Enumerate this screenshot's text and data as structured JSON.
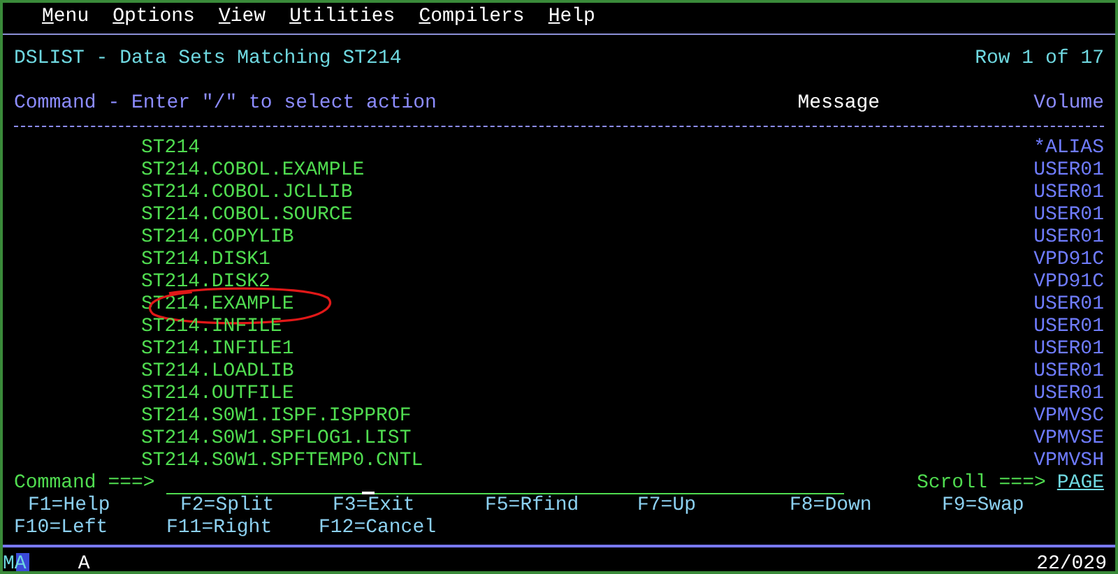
{
  "menu": [
    "Menu",
    "Options",
    "View",
    "Utilities",
    "Compilers",
    "Help"
  ],
  "title": "DSLIST - Data Sets Matching ST214",
  "row_info": "Row 1 of 17",
  "header": {
    "command": "Command - Enter \"/\" to select action",
    "message": "Message",
    "volume": "Volume"
  },
  "rows": [
    {
      "name": "ST214",
      "volume": "*ALIAS",
      "circled": false
    },
    {
      "name": "ST214.COBOL.EXAMPLE",
      "volume": "USER01",
      "circled": false
    },
    {
      "name": "ST214.COBOL.JCLLIB",
      "volume": "USER01",
      "circled": false
    },
    {
      "name": "ST214.COBOL.SOURCE",
      "volume": "USER01",
      "circled": false
    },
    {
      "name": "ST214.COPYLIB",
      "volume": "USER01",
      "circled": false
    },
    {
      "name": "ST214.DISK1",
      "volume": "VPD91C",
      "circled": false
    },
    {
      "name": "ST214.DISK2",
      "volume": "VPD91C",
      "circled": false
    },
    {
      "name": "ST214.EXAMPLE",
      "volume": "USER01",
      "circled": true
    },
    {
      "name": "ST214.INFILE",
      "volume": "USER01",
      "circled": false
    },
    {
      "name": "ST214.INFILE1",
      "volume": "USER01",
      "circled": false
    },
    {
      "name": "ST214.LOADLIB",
      "volume": "USER01",
      "circled": false
    },
    {
      "name": "ST214.OUTFILE",
      "volume": "USER01",
      "circled": false
    },
    {
      "name": "ST214.S0W1.ISPF.ISPPROF",
      "volume": "VPMVSC",
      "circled": false
    },
    {
      "name": "ST214.S0W1.SPFLOG1.LIST",
      "volume": "VPMVSE",
      "circled": false
    },
    {
      "name": "ST214.S0W1.SPFTEMP0.CNTL",
      "volume": "VPMVSH",
      "circled": false
    }
  ],
  "command_line": {
    "label": "Command ===>",
    "scroll_label": "Scroll ===>",
    "scroll_value": "PAGE"
  },
  "function_keys": [
    [
      "F1=Help",
      "F2=Split",
      "F3=Exit",
      "F5=Rfind",
      "F7=Up",
      "F8=Down",
      "F9=Swap"
    ],
    [
      "F10=Left",
      "F11=Right",
      "F12=Cancel"
    ]
  ],
  "status": {
    "session": "MA",
    "mode": "A",
    "position": "22/029"
  }
}
